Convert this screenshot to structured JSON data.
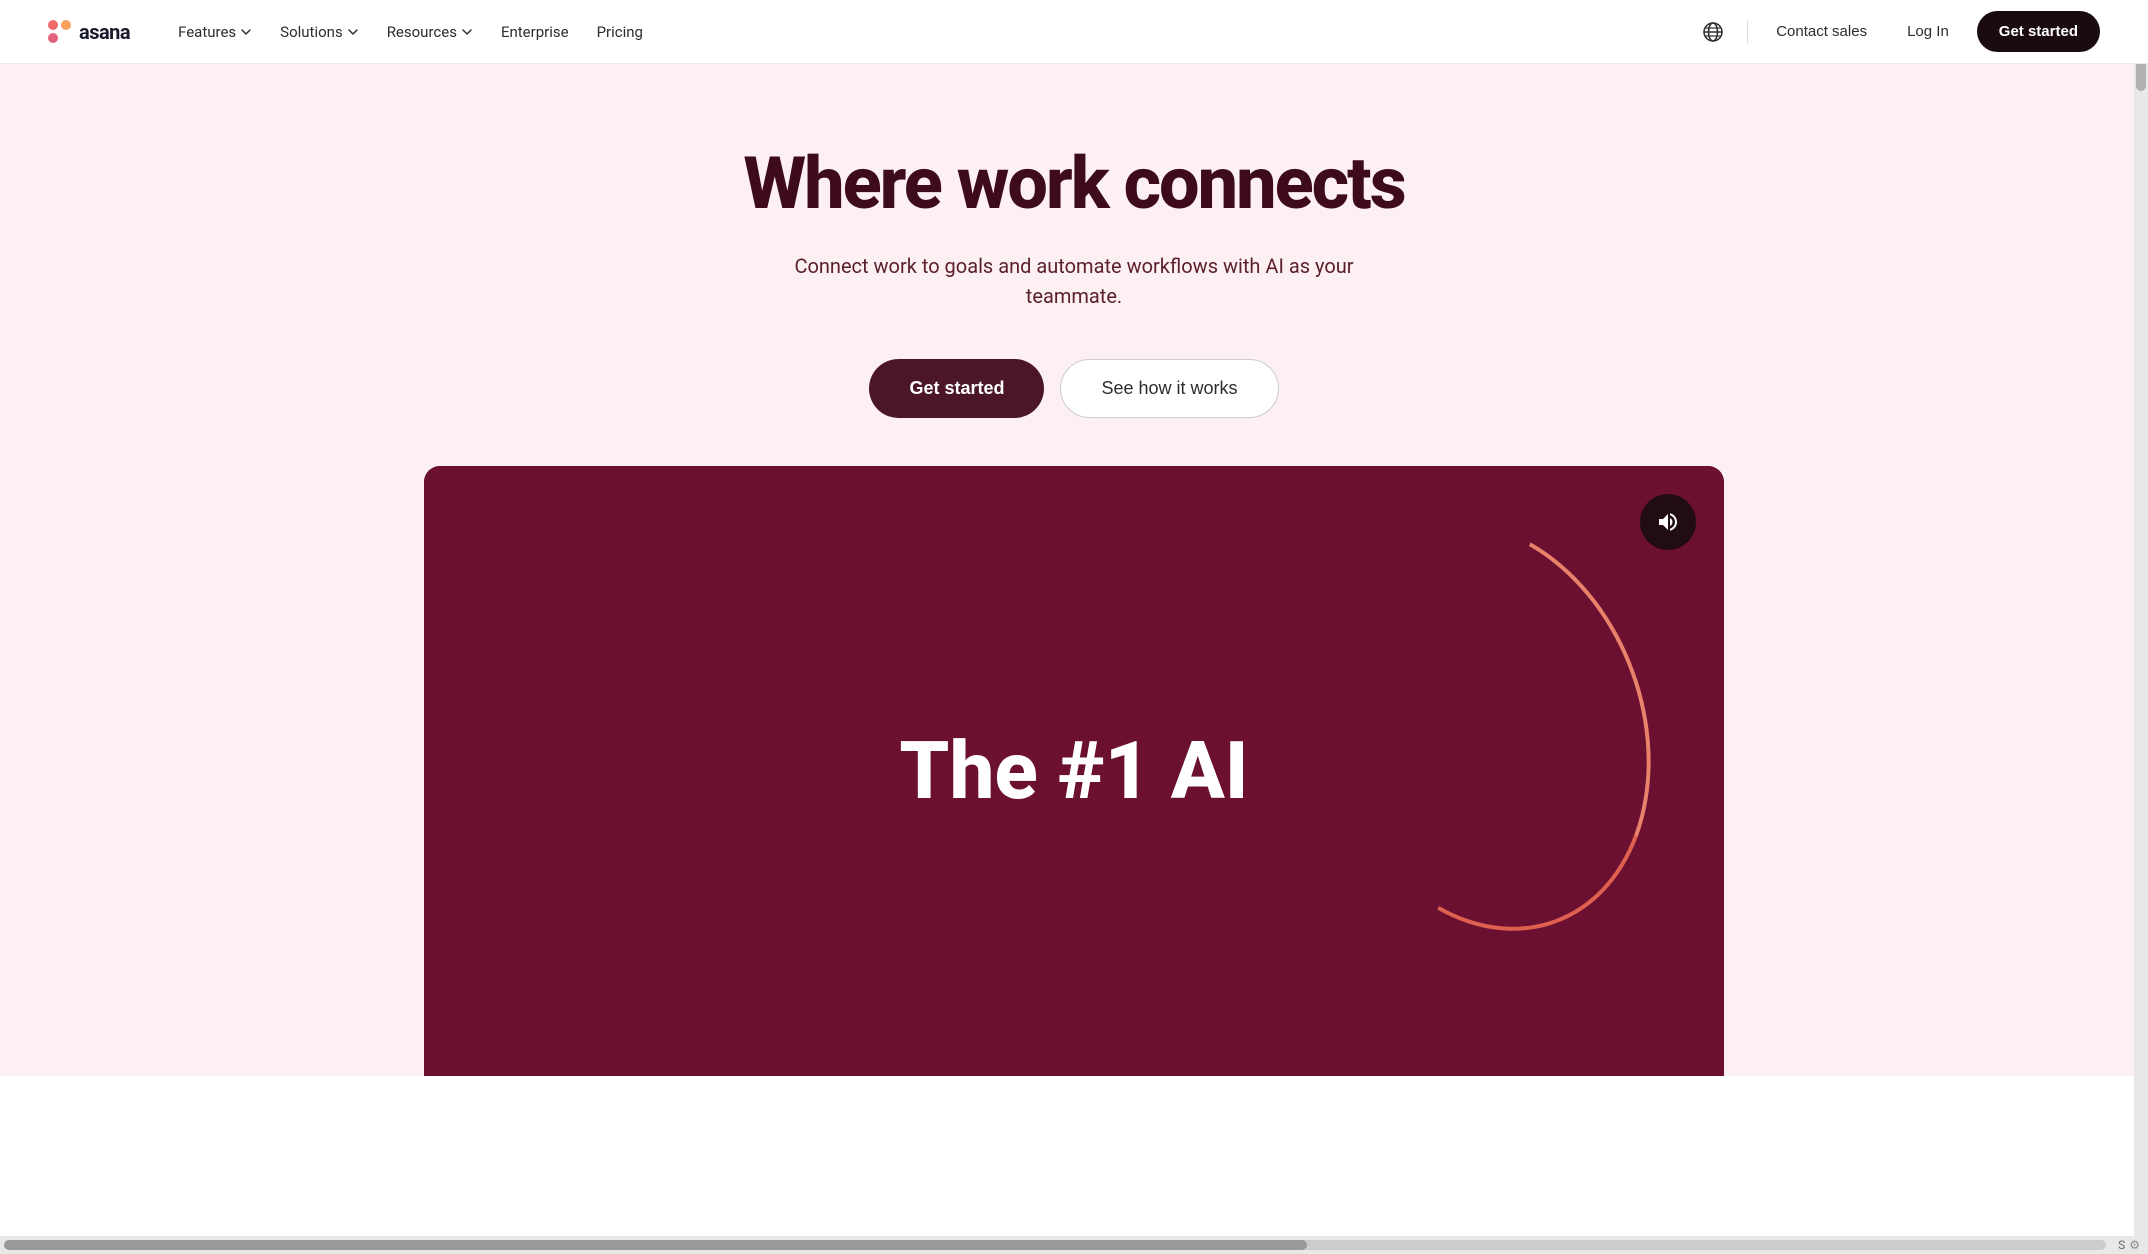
{
  "brand": {
    "name": "asana",
    "logo_alt": "Asana logo"
  },
  "navbar": {
    "features_label": "Features",
    "solutions_label": "Solutions",
    "resources_label": "Resources",
    "enterprise_label": "Enterprise",
    "pricing_label": "Pricing",
    "contact_sales_label": "Contact sales",
    "login_label": "Log In",
    "get_started_label": "Get started",
    "globe_title": "Language selector"
  },
  "hero": {
    "title": "Where work connects",
    "subtitle": "Connect work to goals and automate workflows with AI as your teammate.",
    "get_started_label": "Get started",
    "see_how_label": "See how it works"
  },
  "video": {
    "main_text": "The #1 AI",
    "sound_button_label": "Toggle sound"
  }
}
